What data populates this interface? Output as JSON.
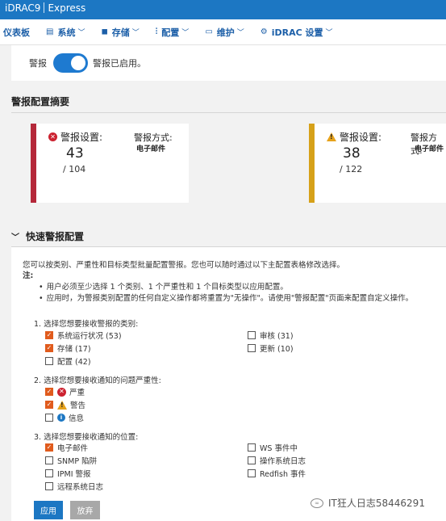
{
  "topbar": {
    "product": "iDRAC9",
    "edition": "Express"
  },
  "nav": [
    {
      "label": "仪表板",
      "icon": "",
      "chevron": ""
    },
    {
      "label": "系统",
      "icon": "▤",
      "chevron": "﹀"
    },
    {
      "label": "存储",
      "icon": "◼",
      "chevron": "﹀"
    },
    {
      "label": "配置",
      "icon": "⫶",
      "chevron": "﹀"
    },
    {
      "label": "维护",
      "icon": "▭",
      "chevron": "﹀"
    },
    {
      "label": "iDRAC 设置",
      "icon": "⚙",
      "chevron": "﹀"
    }
  ],
  "alert_toggle": {
    "label": "警报",
    "status": "警报已启用。",
    "enabled": true
  },
  "summary": {
    "heading": "警报配置摘要",
    "cards": [
      {
        "title": "警报设置:",
        "count": "43",
        "total": "/ 104",
        "method_label": "警报方式:",
        "method_value": "电子邮件",
        "color": "#b5283a",
        "icon": "error-icon"
      },
      {
        "title": "警报设置:",
        "count": "38",
        "total": "/ 122",
        "method_label": "警报方式:",
        "method_value": "电子邮件",
        "color": "#d6a119",
        "icon": "warning-icon"
      }
    ]
  },
  "quick": {
    "heading": "快速警报配置",
    "chevron": "﹀",
    "intro": "您可以按类别、严重性和目标类型批量配置警报。您也可以随时通过以下主配置表格修改选择。",
    "note_label": "注:",
    "notes": [
      "用户必须至少选择 1 个类别、1 个严重性和 1 个目标类型以应用配置。",
      "应用时，为警报类别配置的任何自定义操作都将重置为\"无操作\"。请使用\"警报配置\"页面来配置自定义操作。"
    ],
    "step1": {
      "label": "1. 选择您想要接收警报的类别:",
      "items": [
        {
          "label": "系统运行状况 (53)",
          "checked": true
        },
        {
          "label": "存储 (17)",
          "checked": true
        },
        {
          "label": "配置 (42)",
          "checked": false
        },
        {
          "label": "审核 (31)",
          "checked": false
        },
        {
          "label": "更新 (10)",
          "checked": false
        }
      ]
    },
    "step2": {
      "label": "2. 选择您想要接收通知的问题严重性:",
      "items": [
        {
          "label": "严重",
          "checked": true,
          "icon": "error-icon"
        },
        {
          "label": "警告",
          "checked": true,
          "icon": "warning-icon"
        },
        {
          "label": "信息",
          "checked": false,
          "icon": "info-icon"
        }
      ]
    },
    "step3": {
      "label": "3. 选择您想要接收通知的位置:",
      "items": [
        {
          "label": "电子邮件",
          "checked": true
        },
        {
          "label": "SNMP 陷阱",
          "checked": false
        },
        {
          "label": "IPMI 警报",
          "checked": false
        },
        {
          "label": "远程系统日志",
          "checked": false
        },
        {
          "label": "WS 事件中",
          "checked": false
        },
        {
          "label": "操作系统日志",
          "checked": false
        },
        {
          "label": "Redfish 事件",
          "checked": false
        }
      ]
    },
    "buttons": {
      "apply": "应用",
      "discard": "放弃"
    }
  },
  "watermark": "IT狂人日志58446291",
  "colors": {
    "brand": "#1c77c3",
    "checkbox": "#e05b1d"
  }
}
